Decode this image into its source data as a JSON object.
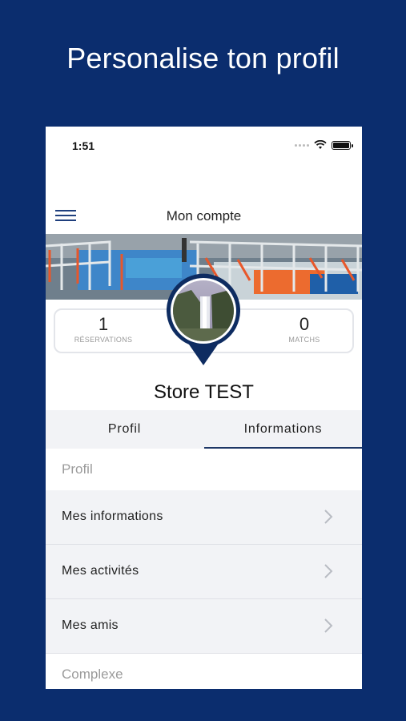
{
  "headline": "Personalise ton profil",
  "status_bar": {
    "time": "1:51"
  },
  "navbar": {
    "title": "Mon compte"
  },
  "stats": [
    {
      "value": "1",
      "label": "RÉSERVATIONS"
    },
    {
      "value": "0",
      "label": "MATCHS"
    }
  ],
  "user": {
    "name": "Store TEST"
  },
  "tabs": [
    {
      "label": "Profil",
      "active": false
    },
    {
      "label": "Informations",
      "active": true
    }
  ],
  "sections": [
    {
      "header": "Profil"
    },
    {
      "header": "Complexe"
    }
  ],
  "menu_items": [
    {
      "label": "Mes informations"
    },
    {
      "label": "Mes activités"
    },
    {
      "label": "Mes amis"
    }
  ],
  "colors": {
    "background": "#0b2d6e",
    "accent": "#1d3766",
    "pin": "#0e2c61"
  },
  "icons": [
    "menu-icon",
    "wifi-icon",
    "battery-icon",
    "chevron-right-icon",
    "avatar-pin"
  ]
}
